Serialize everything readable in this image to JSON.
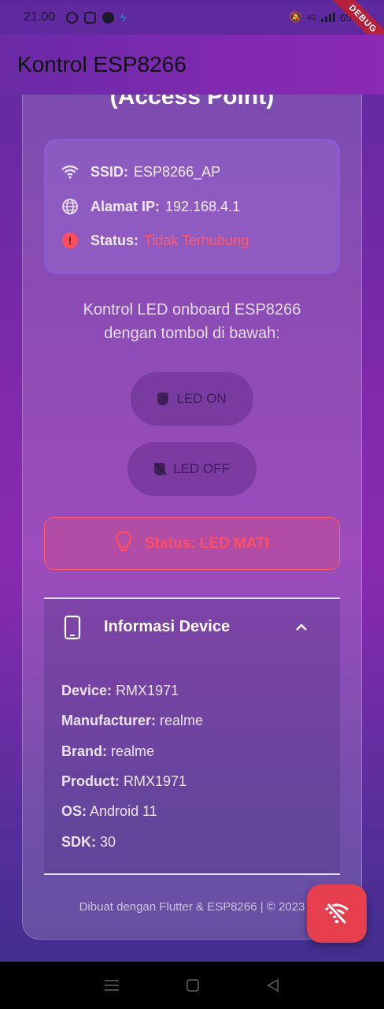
{
  "status_bar": {
    "time": "21.00",
    "battery": "65%",
    "network": "4G"
  },
  "debug_banner": "DEBUG",
  "app_bar": {
    "title": "Kontrol ESP8266"
  },
  "card": {
    "title": "(Access Point)",
    "info": {
      "ssid_label": "SSID:",
      "ssid_value": "ESP8266_AP",
      "ip_label": "Alamat IP:",
      "ip_value": "192.168.4.1",
      "status_label": "Status:",
      "status_value": "Tidak Terhubung"
    },
    "description_line1": "Kontrol LED onboard ESP8266",
    "description_line2": "dengan tombol di bawah:",
    "led_on_label": "LED ON",
    "led_off_label": "LED OFF",
    "led_status": "Status: LED MATI"
  },
  "device_info": {
    "title": "Informasi Device",
    "rows": [
      {
        "label": "Device:",
        "value": "RMX1971"
      },
      {
        "label": "Manufacturer:",
        "value": "realme"
      },
      {
        "label": "Brand:",
        "value": "realme"
      },
      {
        "label": "Product:",
        "value": "RMX1971"
      },
      {
        "label": "OS:",
        "value": "Android 11"
      },
      {
        "label": "SDK:",
        "value": "30"
      }
    ]
  },
  "footer": "Dibuat dengan Flutter & ESP8266 | © 2023",
  "colors": {
    "accent_red": "#e53e4c",
    "error_text": "#ff5a6a",
    "app_bar": "#7f2ab0"
  },
  "icons": {
    "wifi": "wifi-icon",
    "globe": "globe-icon",
    "error": "error-icon",
    "plug": "plug-icon",
    "plug_off": "plug-off-icon",
    "bulb": "lightbulb-icon",
    "phone": "phone-icon",
    "chevron": "chevron-up-icon",
    "wifi_off": "wifi-off-icon"
  }
}
